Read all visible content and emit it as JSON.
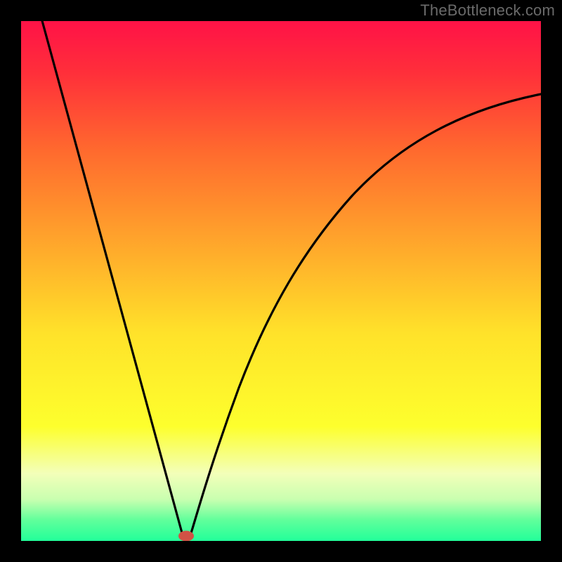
{
  "watermark": "TheBottleneck.com",
  "chart_data": {
    "type": "line",
    "title": "",
    "xlabel": "",
    "ylabel": "",
    "xlim": [
      0,
      100
    ],
    "ylim": [
      0,
      100
    ],
    "grid": false,
    "legend": false,
    "background_gradient": {
      "stops": [
        {
          "offset": 0.0,
          "color": "#ff1247"
        },
        {
          "offset": 0.1,
          "color": "#ff2f3a"
        },
        {
          "offset": 0.25,
          "color": "#ff6a2e"
        },
        {
          "offset": 0.45,
          "color": "#ffae2b"
        },
        {
          "offset": 0.6,
          "color": "#ffe22a"
        },
        {
          "offset": 0.78,
          "color": "#fdff2d"
        },
        {
          "offset": 0.87,
          "color": "#f3ffb9"
        },
        {
          "offset": 0.92,
          "color": "#c9ffb0"
        },
        {
          "offset": 0.96,
          "color": "#60ff9b"
        },
        {
          "offset": 1.0,
          "color": "#22ff9a"
        }
      ]
    },
    "series": [
      {
        "name": "left-branch",
        "description": "steep descending line from top-left into the cusp",
        "points": [
          {
            "x": 4.0,
            "y": 100.0
          },
          {
            "x": 31.0,
            "y": 1.0
          }
        ]
      },
      {
        "name": "right-branch",
        "description": "curve rising from the cusp and flattening toward the right edge",
        "points": [
          {
            "x": 32.5,
            "y": 1.0
          },
          {
            "x": 34.0,
            "y": 6.0
          },
          {
            "x": 38.0,
            "y": 20.0
          },
          {
            "x": 44.0,
            "y": 37.0
          },
          {
            "x": 52.0,
            "y": 53.0
          },
          {
            "x": 62.0,
            "y": 66.0
          },
          {
            "x": 74.0,
            "y": 76.0
          },
          {
            "x": 88.0,
            "y": 82.5
          },
          {
            "x": 100.0,
            "y": 86.0
          }
        ]
      }
    ],
    "marker": {
      "name": "cusp-marker",
      "x": 31.7,
      "y": 0.9,
      "color": "#d15245"
    }
  }
}
